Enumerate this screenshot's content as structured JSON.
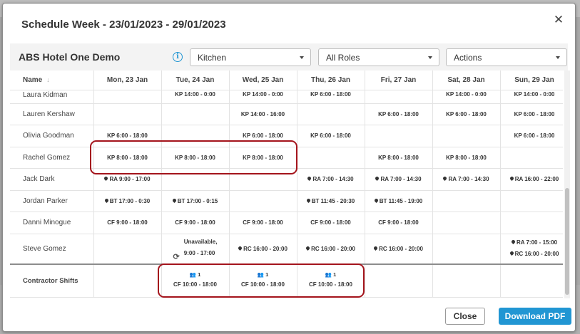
{
  "modal": {
    "title": "Schedule Week - 23/01/2023 - 29/01/2023",
    "close_icon": "close-icon"
  },
  "toolbar": {
    "hotel_name": "ABS Hotel One Demo",
    "info_icon": "i",
    "department_select": "Kitchen",
    "roles_select": "All Roles",
    "actions_select": "Actions"
  },
  "table": {
    "name_header": "Name",
    "sort_icon": "↓",
    "days": [
      "Mon, 23 Jan",
      "Tue, 24 Jan",
      "Wed, 25 Jan",
      "Thu, 26 Jan",
      "Fri, 27 Jan",
      "Sat, 28 Jan",
      "Sun, 29 Jan"
    ],
    "rows": [
      {
        "name": "Laura Kidman",
        "cells": [
          "",
          "KP 14:00 - 0:00",
          "KP 14:00 - 0:00",
          "KP 6:00 - 18:00",
          "",
          "KP 14:00 - 0:00",
          "KP 14:00 - 0:00"
        ]
      },
      {
        "name": "Lauren Kershaw",
        "cells": [
          "",
          "",
          "KP 14:00 - 16:00",
          "",
          "KP 6:00 - 18:00",
          "KP 6:00 - 18:00",
          "KP 6:00 - 18:00"
        ]
      },
      {
        "name": "Olivia Goodman",
        "cells": [
          "KP 6:00 - 18:00",
          "",
          "KP 6:00 - 18:00",
          "KP 6:00 - 18:00",
          "",
          "",
          "KP 6:00 - 18:00"
        ]
      },
      {
        "name": "Rachel Gomez",
        "cells": [
          "KP 8:00 - 18:00",
          "KP 8:00 - 18:00",
          "KP 8:00 - 18:00",
          "",
          "KP 8:00 - 18:00",
          "KP 8:00 - 18:00",
          ""
        ]
      },
      {
        "name": "Jack Dark",
        "cells": [
          "RA 9:00 - 17:00",
          "",
          "",
          "RA 7:00 - 14:30",
          "RA 7:00 - 14:30",
          "RA 7:00 - 14:30",
          "RA 16:00 - 22:00"
        ]
      },
      {
        "name": "Jordan Parker",
        "cells": [
          "BT 17:00 - 0:30",
          "BT 17:00 - 0:15",
          "",
          "BT 11:45 - 20:30",
          "BT 11:45 - 19:00",
          "",
          ""
        ]
      },
      {
        "name": "Danni Minogue",
        "cells": [
          "CF 9:00 - 18:00",
          "CF 9:00 - 18:00",
          "CF 9:00 - 18:00",
          "CF 9:00 - 18:00",
          "CF 9:00 - 18:00",
          "",
          ""
        ]
      }
    ],
    "steve": {
      "name": "Steve Gomez",
      "tue_line1": "Unavailable,",
      "tue_line2": "9:00 - 17:00",
      "wed": "RC 16:00 - 20:00",
      "thu": "RC 16:00 - 20:00",
      "fri": "RC 16:00 - 20:00",
      "sun_line1": "RA 7:00 - 15:00",
      "sun_line2": "RC 16:00 - 20:00"
    },
    "contractor": {
      "label": "Contractor Shifts",
      "count": "1",
      "shift": "CF 10:00 - 18:00"
    }
  },
  "footer": {
    "close_label": "Close",
    "pdf_label": "Download PDF"
  },
  "colors": {
    "accent": "#2196d3",
    "highlight": "#a4141c"
  }
}
